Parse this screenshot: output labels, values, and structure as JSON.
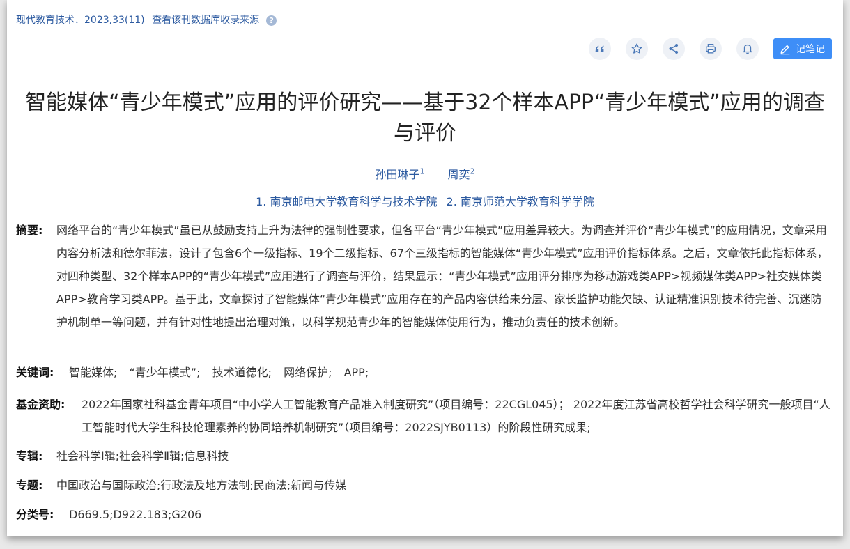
{
  "source": {
    "journal": "现代教育技术．2023,33(11)",
    "link": "查看该刊数据库收录来源",
    "help_icon": "?"
  },
  "toolbar": {
    "quote_icon": "quote-icon",
    "star_icon": "star-icon",
    "share_icon": "share-icon",
    "print_icon": "print-icon",
    "bell_icon": "bell-icon",
    "note_label": "记笔记",
    "accent": "#3e8ef7"
  },
  "title": "智能媒体“青少年模式”应用的评价研究——基于32个样本APP“青少年模式”应用的调查与评价",
  "authors": [
    {
      "name": "孙田琳子",
      "sup": "1"
    },
    {
      "name": "周奕",
      "sup": "2"
    }
  ],
  "orgs": [
    "1. 南京邮电大学教育科学与技术学院",
    "2. 南京师范大学教育科学学院"
  ],
  "abstract": {
    "label": "摘要:",
    "text": "网络平台的“青少年模式”虽已从鼓励支持上升为法律的强制性要求，但各平台“青少年模式”应用差异较大。为调查并评价“青少年模式”的应用情况，文章采用内容分析法和德尔菲法，设计了包含6个一级指标、19个二级指标、67个三级指标的智能媒体“青少年模式”应用评价指标体系。之后，文章依托此指标体系，对四种类型、32个样本APP的“青少年模式”应用进行了调查与评价，结果显示：“青少年模式”应用评分排序为移动游戏类APP>视频媒体类APP>社交媒体类APP>教育学习类APP。基于此，文章探讨了智能媒体“青少年模式”应用存在的产品内容供给未分层、家长监护功能欠缺、认证精准识别技术待完善、沉迷防护机制单一等问题，并有针对性地提出治理对策，以科学规范青少年的智能媒体使用行为，推动负责任的技术创新。"
  },
  "keywords": {
    "label": "关键词:",
    "items": [
      "智能媒体;",
      "“青少年模式”;",
      "技术道德化;",
      "网络保护;",
      "APP;"
    ]
  },
  "fund": {
    "label": "基金资助:",
    "text": "2022年国家社科基金青年项目“中小学人工智能教育产品准入制度研究”（项目编号：22CGL045）； 2022年度江苏省高校哲学社会科学研究一般项目“人工智能时代大学生科技伦理素养的协同培养机制研究”（项目编号：2022SJYB0113）的阶段性研究成果;"
  },
  "album": {
    "label": "专辑:",
    "text": "社会科学Ⅰ辑;社会科学Ⅱ辑;信息科技"
  },
  "topic": {
    "label": "专题:",
    "text": "中国政治与国际政治;行政法及地方法制;民商法;新闻与传媒"
  },
  "classno": {
    "label": "分类号:",
    "text": "D669.5;D922.183;G206"
  }
}
